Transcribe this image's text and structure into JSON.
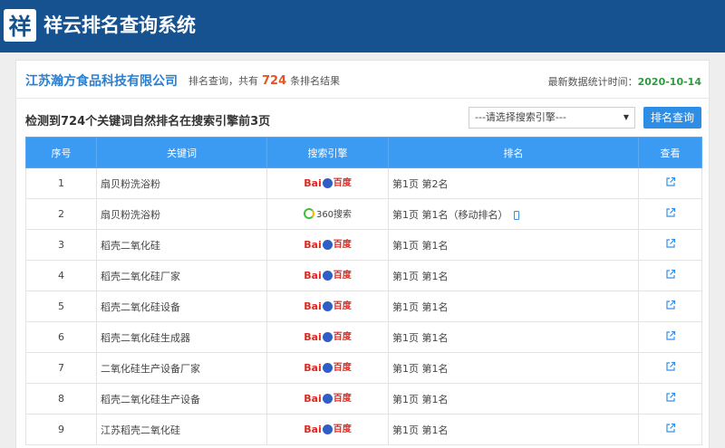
{
  "header": {
    "logo_char": "祥",
    "title": "祥云排名查询系统"
  },
  "info": {
    "company": "江苏瀚方食品科技有限公司",
    "summary_prefix": "排名查询，共有",
    "count": "724",
    "summary_suffix": "条排名结果",
    "stat_label": "最新数据统计时间：",
    "stat_date": "2020-10-14"
  },
  "toolbar": {
    "heading": "检测到724个关键词自然排名在搜索引擎前3页",
    "select_value": "---请选择搜索引擎---",
    "query_label": "排名查询"
  },
  "table": {
    "headers": [
      "序号",
      "关键词",
      "搜索引擎",
      "排名",
      "查看"
    ],
    "rows": [
      {
        "no": "1",
        "keyword": "扇贝粉洗浴粉",
        "engine": "baidu",
        "rank": "第1页 第2名",
        "mobile": false
      },
      {
        "no": "2",
        "keyword": "扇贝粉洗浴粉",
        "engine": "360",
        "rank": "第1页 第1名（移动排名）",
        "mobile": true
      },
      {
        "no": "3",
        "keyword": "稻壳二氧化硅",
        "engine": "baidu",
        "rank": "第1页 第1名",
        "mobile": false
      },
      {
        "no": "4",
        "keyword": "稻壳二氧化硅厂家",
        "engine": "baidu",
        "rank": "第1页 第1名",
        "mobile": false
      },
      {
        "no": "5",
        "keyword": "稻壳二氧化硅设备",
        "engine": "baidu",
        "rank": "第1页 第1名",
        "mobile": false
      },
      {
        "no": "6",
        "keyword": "稻壳二氧化硅生成器",
        "engine": "baidu",
        "rank": "第1页 第1名",
        "mobile": false
      },
      {
        "no": "7",
        "keyword": "二氧化硅生产设备厂家",
        "engine": "baidu",
        "rank": "第1页 第1名",
        "mobile": false
      },
      {
        "no": "8",
        "keyword": "稻壳二氧化硅生产设备",
        "engine": "baidu",
        "rank": "第1页 第1名",
        "mobile": false
      },
      {
        "no": "9",
        "keyword": "江苏稻壳二氧化硅",
        "engine": "baidu",
        "rank": "第1页 第1名",
        "mobile": false
      }
    ]
  },
  "engines": {
    "baidu": {
      "bai": "Bai",
      "du": "百度",
      "icon": "baidu-paw-icon"
    },
    "360": {
      "text": "360搜索",
      "icon": "360-ring-icon"
    }
  },
  "icons": {
    "view": "external-link-icon",
    "mobile": "mobile-phone-icon"
  },
  "colors": {
    "header_bg": "#15528f",
    "table_header_bg": "#3b9af2",
    "company": "#2a7fd1",
    "count": "#e0562a",
    "date": "#2e9a3e",
    "button": "#2e8ee6"
  }
}
